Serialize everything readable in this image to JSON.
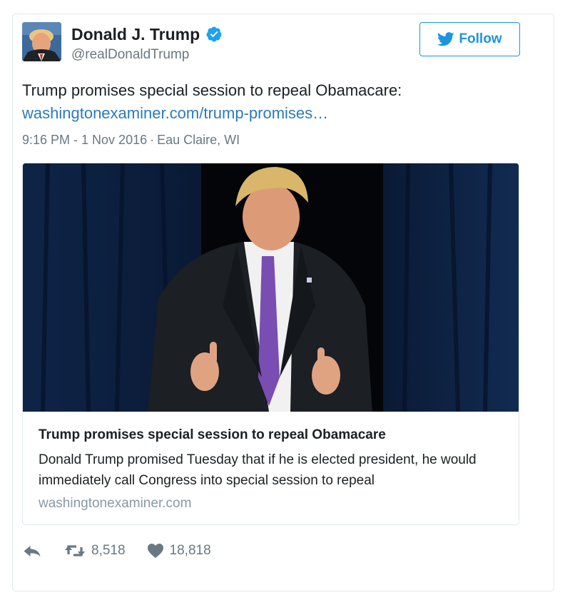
{
  "user": {
    "display_name": "Donald J. Trump",
    "handle": "@realDonaldTrump",
    "verified": true
  },
  "follow_button": {
    "label": "Follow",
    "color": "#1b95e0"
  },
  "tweet": {
    "text": "Trump promises special session to repeal Obamacare:",
    "link_text": "washingtonexaminer.com/trump-promises…",
    "time": "9:16 PM - 1 Nov 2016",
    "separator": "·",
    "location": "Eau Claire, WI"
  },
  "card": {
    "title": "Trump promises special session to repeal Obamacare",
    "description": "Donald Trump promised Tuesday that if he is elected president, he would immediately call Congress into special session to repeal",
    "domain": "washingtonexaminer.com"
  },
  "actions": {
    "reply_icon": "reply-icon",
    "retweet_icon": "retweet-icon",
    "retweet_count": "8,518",
    "like_icon": "heart-icon",
    "like_count": "18,818"
  },
  "colors": {
    "link": "#2b7bb9",
    "muted": "#697882",
    "border": "#e1e8ed",
    "text": "#1c2022"
  }
}
